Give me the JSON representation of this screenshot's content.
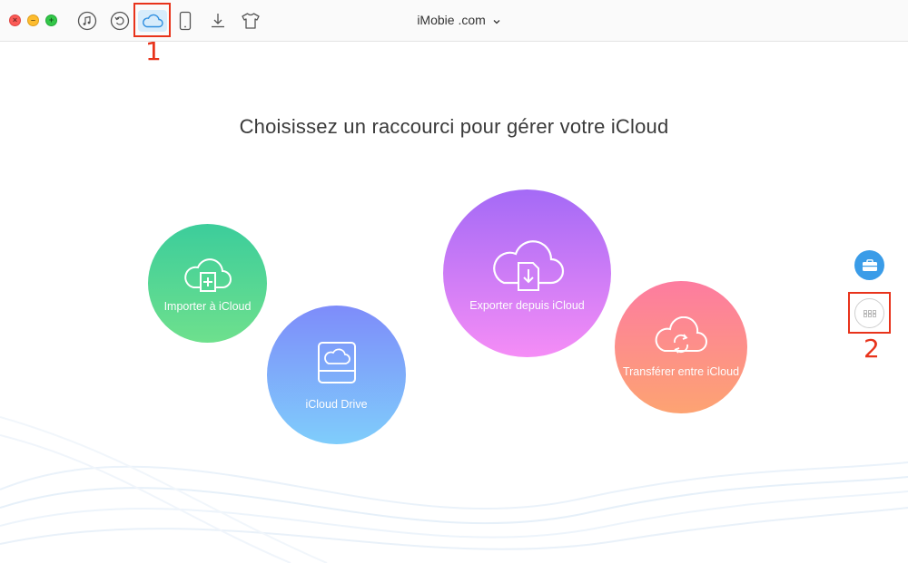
{
  "window": {
    "title": "iMobie .com",
    "controls": [
      "close",
      "minimize",
      "maximize"
    ]
  },
  "toolbar": {
    "items": [
      {
        "icon": "music-note-icon",
        "active": false
      },
      {
        "icon": "restore-icon",
        "active": false
      },
      {
        "icon": "cloud-icon",
        "active": true
      },
      {
        "icon": "phone-icon",
        "active": false
      },
      {
        "icon": "download-icon",
        "active": false
      },
      {
        "icon": "tshirt-icon",
        "active": false
      }
    ]
  },
  "annotations": {
    "one": "1",
    "two": "2",
    "color": "#e8331b"
  },
  "main": {
    "headline": "Choisissez un raccourci pour gérer votre iCloud",
    "shortcuts": [
      {
        "label": "Importer à iCloud",
        "icon": "cloud-add-icon",
        "color_top": "#3ccd9b",
        "color_bottom": "#6ee08d"
      },
      {
        "label": "iCloud Drive",
        "icon": "drive-icon",
        "color_top": "#7e8cfa",
        "color_bottom": "#7fcdfb"
      },
      {
        "label": "Exporter depuis iCloud",
        "icon": "cloud-export-icon",
        "color_top": "#a46af6",
        "color_bottom": "#f58df6"
      },
      {
        "label": "Transférer entre iCloud",
        "icon": "cloud-sync-icon",
        "color_top": "#fd7ca0",
        "color_bottom": "#fda372"
      }
    ]
  },
  "side": {
    "toolbox_icon": "toolbox-icon",
    "grid_icon": "grid-icon",
    "accent": "#3a9ce8"
  }
}
